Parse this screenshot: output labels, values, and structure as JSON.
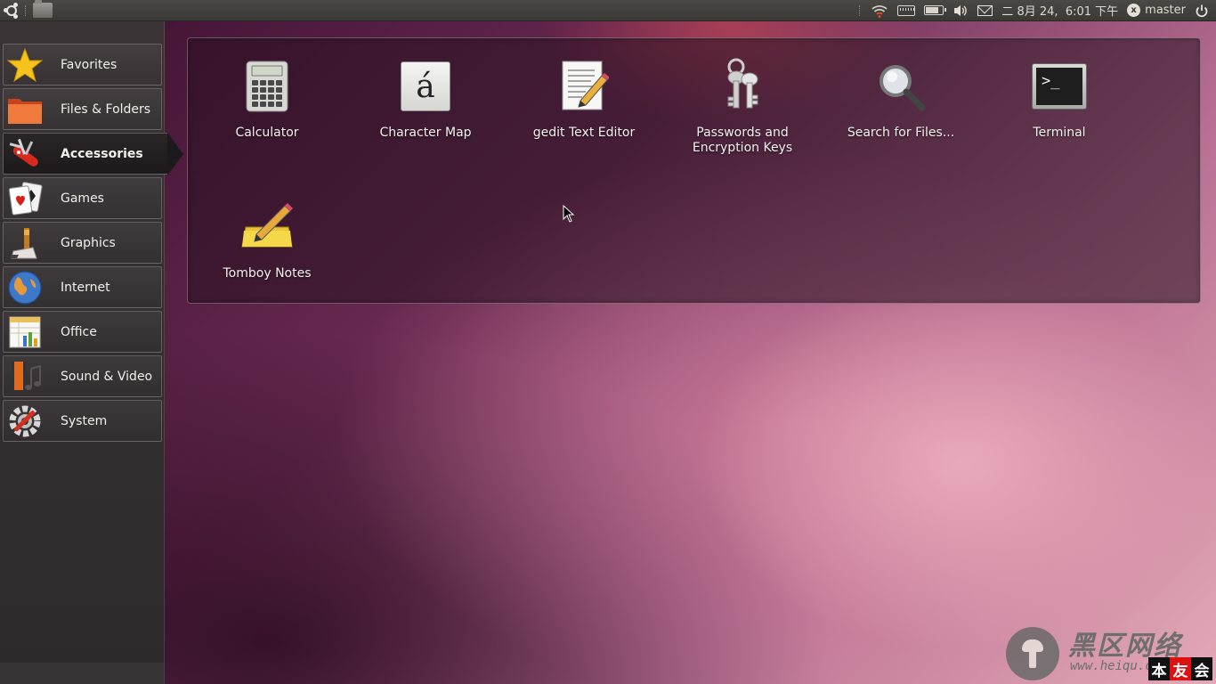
{
  "top_panel": {
    "icons": {
      "logo": "ubuntu-logo-icon",
      "places": "folder-icon",
      "network": "wifi-icon",
      "keyboard": "keyboard-icon",
      "battery": "battery-icon",
      "volume": "volume-icon",
      "mail": "mail-icon",
      "user": "user-status-icon",
      "power": "power-icon"
    },
    "battery_level": 0.85,
    "clock": "二 8月 24,  6:01 下午",
    "user_name": "master",
    "user_status_glyph": "x"
  },
  "sidebar": {
    "items": [
      {
        "label": "Favorites",
        "icon": "star-icon",
        "active": false
      },
      {
        "label": "Files & Folders",
        "icon": "folder-icon",
        "active": false
      },
      {
        "label": "Accessories",
        "icon": "swiss-knife-icon",
        "active": true
      },
      {
        "label": "Games",
        "icon": "playing-cards-icon",
        "active": false
      },
      {
        "label": "Graphics",
        "icon": "paint-tube-icon",
        "active": false
      },
      {
        "label": "Internet",
        "icon": "globe-icon",
        "active": false
      },
      {
        "label": "Office",
        "icon": "spreadsheet-icon",
        "active": false
      },
      {
        "label": "Sound & Video",
        "icon": "film-music-icon",
        "active": false
      },
      {
        "label": "System",
        "icon": "gear-wrench-icon",
        "active": false
      }
    ]
  },
  "apps": [
    {
      "label": "Calculator",
      "icon": "calculator-icon"
    },
    {
      "label": "Character Map",
      "icon": "character-map-icon",
      "glyph": "á"
    },
    {
      "label": "gedit Text Editor",
      "icon": "text-editor-icon"
    },
    {
      "label": "Passwords and\nEncryption Keys",
      "icon": "keys-icon"
    },
    {
      "label": "Search for Files...",
      "icon": "magnifier-icon"
    },
    {
      "label": "Terminal",
      "icon": "terminal-icon",
      "glyph": ">_"
    },
    {
      "label": "Tomboy Notes",
      "icon": "notepad-pencil-icon"
    }
  ],
  "watermark": {
    "title": "黑区网络",
    "subtitle": "www.heiqu.com",
    "badge": [
      "本",
      "友",
      "会"
    ]
  }
}
